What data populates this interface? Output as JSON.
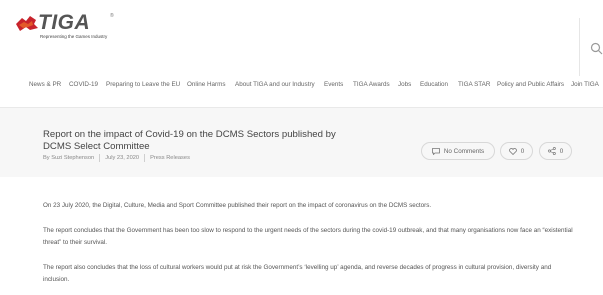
{
  "logo": {
    "name": "TIGA",
    "trademark": "®",
    "tagline": "Representing the Games Industry",
    "brand_color": "#c8232c"
  },
  "search": {
    "icon": "search-icon"
  },
  "nav": {
    "items": [
      "News & PR",
      "COVID-19",
      "Preparing to Leave the EU",
      "Online Harms",
      "About TIGA and our Industry",
      "Events",
      "TIGA Awards",
      "Jobs",
      "Education",
      "TIGA STAR",
      "Policy and Public Affairs",
      "Join TIGA"
    ]
  },
  "post": {
    "title": "Report on the impact of Covid-19 on the DCMS Sectors published by DCMS Select Committee",
    "author": "By Suzi Stephenson",
    "date": "July 23, 2020",
    "category": "Press Releases",
    "comments_label": "No Comments",
    "likes_count": "0",
    "shares_count": "0"
  },
  "content": {
    "paragraphs": [
      "On 23 July 2020, the Digital, Culture, Media and Sport Committee published their report on the impact of coronavirus on the DCMS sectors.",
      "The report concludes that the Government has been too slow to respond to the urgent needs of the sectors during the covid-19 outbreak, and that many organisations now face an “existential threat” to their survival.",
      "The report also concludes that the loss of cultural workers would put at risk the Government’s ‘levelling up’ agenda, and reverse decades of progress in cultural provision, diversity and inclusion."
    ]
  }
}
